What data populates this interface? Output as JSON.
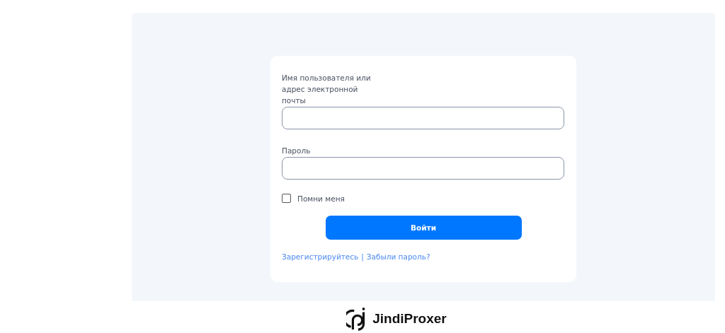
{
  "form": {
    "fields": [
      {
        "label": "Имя пользователя или адрес электронной почты"
      },
      {
        "label": "Пароль"
      }
    ],
    "remember": {
      "label": "Помни меня",
      "checked": false
    },
    "submit": "Войти",
    "links": [
      {
        "label": "Зарегистрируйтесь"
      },
      {
        "label": "Забыли пароль?"
      }
    ],
    "separator": "|"
  },
  "footer": {
    "brand": "JindiProxer"
  }
}
